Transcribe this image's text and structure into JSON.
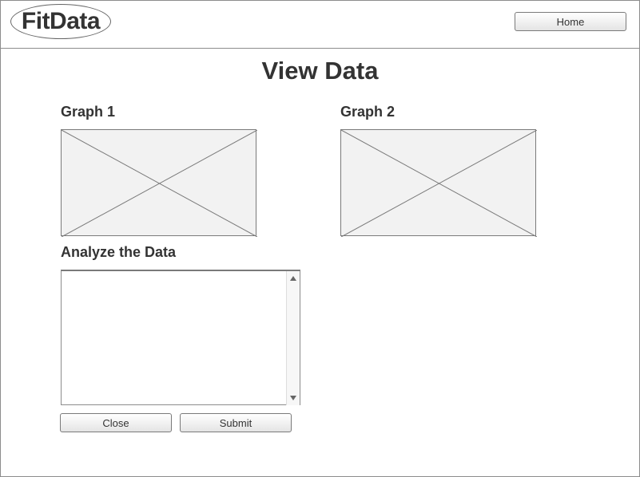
{
  "header": {
    "logo_text": "FitData",
    "home_label": "Home"
  },
  "main": {
    "title": "View Data",
    "graph1_label": "Graph 1",
    "graph2_label": "Graph 2",
    "analyze_label": "Analyze the Data",
    "analyze_value": "",
    "close_label": "Close",
    "submit_label": "Submit"
  },
  "colors": {
    "border": "#8c8c8c",
    "text": "#333333",
    "placeholder_fill": "#f2f2f2"
  },
  "icons": {
    "graph_placeholder": "image-placeholder-icon",
    "scroll_up": "arrow-up-icon",
    "scroll_down": "arrow-down-icon"
  }
}
